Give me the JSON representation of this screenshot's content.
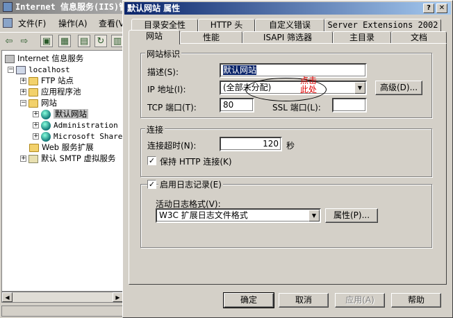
{
  "mmc": {
    "title": "Internet 信息服务(IIS)管",
    "menu": [
      "文件(F)",
      "操作(A)",
      "查看(V)"
    ],
    "tree": [
      {
        "label": "Internet 信息服务"
      },
      {
        "label": "localhost"
      },
      {
        "label": "FTP 站点"
      },
      {
        "label": "应用程序池"
      },
      {
        "label": "网站"
      },
      {
        "label": "默认网站"
      },
      {
        "label": "Administration"
      },
      {
        "label": "Microsoft Share"
      },
      {
        "label": "Web 服务扩展"
      },
      {
        "label": "默认 SMTP 虚拟服务"
      }
    ]
  },
  "dialog": {
    "title": "默认网站 属性",
    "help_btn": "?",
    "close_btn": "✕",
    "tabs_row1": [
      "目录安全性",
      "HTTP 头",
      "自定义错误",
      "Server Extensions 2002"
    ],
    "tabs_row2": [
      "网站",
      "性能",
      "ISAPI 筛选器",
      "主目录",
      "文档"
    ],
    "identity": {
      "group": "网站标识",
      "desc_label": "描述(S):",
      "desc_value": "默认网站",
      "ip_label": "IP 地址(I):",
      "ip_value": "(全部未分配)",
      "advanced_btn": "高级(D)...",
      "tcp_label": "TCP 端口(T):",
      "tcp_value": "80",
      "ssl_label": "SSL 端口(L):",
      "ssl_value": ""
    },
    "connection": {
      "group": "连接",
      "timeout_label": "连接超时(N):",
      "timeout_value": "120",
      "timeout_unit": "秒",
      "keepalive_label": "保持 HTTP 连接(K)",
      "keepalive_checked": true
    },
    "logging": {
      "enable_label": "启用日志记录(E)",
      "enable_checked": true,
      "format_label": "活动日志格式(V):",
      "format_value": "W3C 扩展日志文件格式",
      "props_btn": "属性(P)..."
    },
    "buttons": {
      "ok": "确定",
      "cancel": "取消",
      "apply": "应用(A)",
      "help": "帮助"
    }
  },
  "annotation": {
    "text": "点击此处",
    "color": "#e00000"
  }
}
